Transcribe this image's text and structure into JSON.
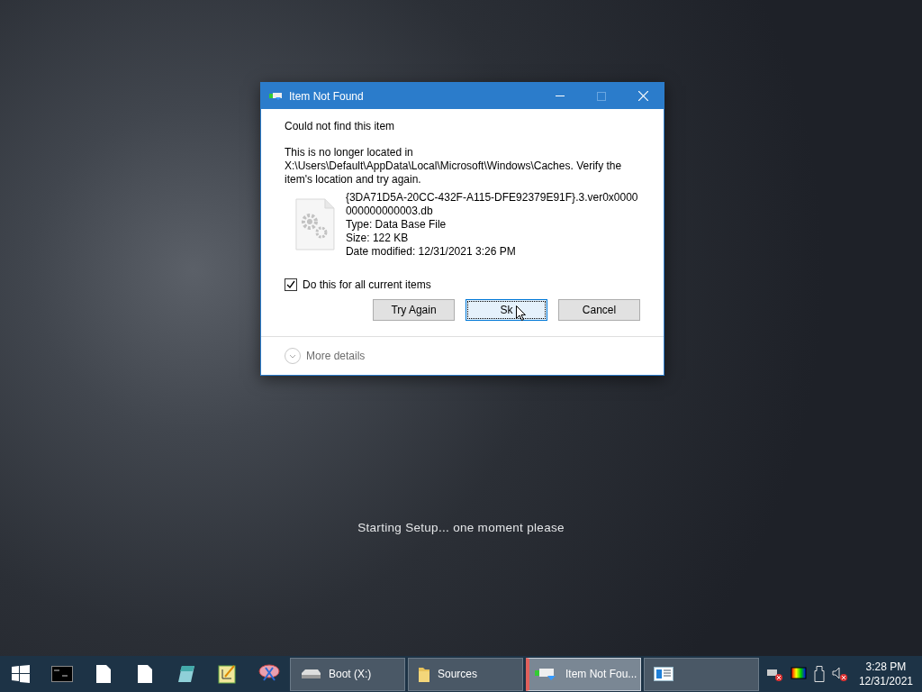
{
  "dialog": {
    "title": "Item Not Found",
    "heading": "Could not find this item",
    "message": "This is no longer located in X:\\Users\\Default\\AppData\\Local\\Microsoft\\Windows\\Caches. Verify the item's location and try again.",
    "file": {
      "name": "{3DA71D5A-20CC-432F-A115-DFE92379E91F}.3.ver0x0000000000000003.db",
      "type": "Type: Data Base File",
      "size": "Size: 122 KB",
      "modified": "Date modified: 12/31/2021 3:26 PM"
    },
    "checkbox": {
      "label": "Do this for all current items",
      "checked": true
    },
    "buttons": [
      {
        "label": "Try Again",
        "focused": false
      },
      {
        "label": "Sk",
        "focused": true
      },
      {
        "label": "Cancel",
        "focused": false
      }
    ],
    "more_details": "More details"
  },
  "status_text": "Starting Setup... one moment please",
  "taskbar": {
    "windows": [
      {
        "kind": "drive",
        "label": "Boot (X:)",
        "selected": false
      },
      {
        "kind": "folder",
        "label": "Sources",
        "selected": false
      },
      {
        "kind": "dialog",
        "label": "Item Not Fou...",
        "selected": true
      },
      {
        "kind": "window",
        "selected": false
      }
    ],
    "clock": {
      "time": "3:28 PM",
      "date": "12/31/2021"
    }
  }
}
